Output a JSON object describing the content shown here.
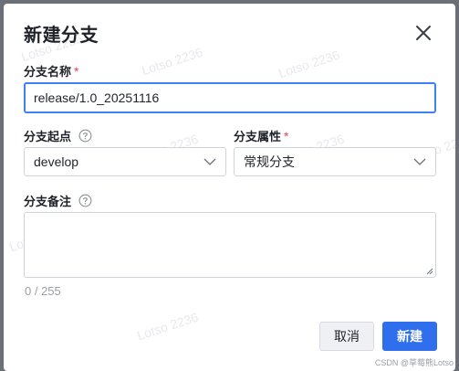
{
  "dialog": {
    "title": "新建分支",
    "close_icon": "close-icon"
  },
  "fields": {
    "branch_name": {
      "label": "分支名称",
      "required_mark": "*",
      "value": "release/1.0_20251116"
    },
    "branch_start": {
      "label": "分支起点",
      "help_icon": "question-circle-icon",
      "value": "develop"
    },
    "branch_type": {
      "label": "分支属性",
      "required_mark": "*",
      "value": "常规分支"
    },
    "branch_note": {
      "label": "分支备注",
      "help_icon": "question-circle-icon",
      "value": "",
      "counter": "0 / 255"
    }
  },
  "buttons": {
    "cancel": "取消",
    "create": "新建"
  },
  "watermark": "Lotso 2236",
  "credit": "CSDN @草莓熊Lotso",
  "colors": {
    "primary": "#2f6fed",
    "focus_border": "#3b82f6",
    "required": "#e5484d"
  }
}
